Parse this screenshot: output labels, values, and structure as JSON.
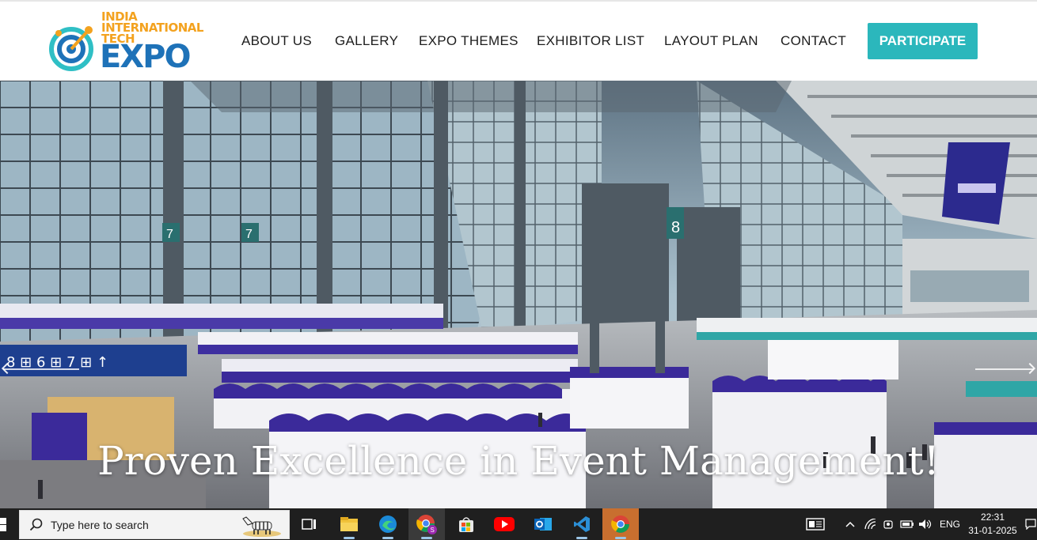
{
  "header": {
    "logo": {
      "line1": "INDIA",
      "line2": "INTERNATIONAL",
      "line3": "TECH",
      "expo": "EXPO"
    },
    "nav": [
      {
        "label": "ABOUT US"
      },
      {
        "label": "GALLERY"
      },
      {
        "label": "EXPO THEMES"
      },
      {
        "label": "EXHIBITOR LIST"
      },
      {
        "label": "LAYOUT PLAN"
      },
      {
        "label": "CONTACT"
      }
    ],
    "cta_label": "PARTICIPATE"
  },
  "hero": {
    "caption": "Proven Excellence in Event Management!",
    "signage": {
      "hall_numbers": [
        "8",
        "6",
        "7",
        "7",
        "8"
      ],
      "sign_text": "8 号门  6 号门   7 号门 ↑"
    }
  },
  "taskbar": {
    "search_placeholder": "Type here to search",
    "apps": [
      {
        "name": "task-view-icon"
      },
      {
        "name": "file-explorer-icon"
      },
      {
        "name": "edge-icon"
      },
      {
        "name": "chrome-profile-icon"
      },
      {
        "name": "microsoft-store-icon"
      },
      {
        "name": "youtube-icon"
      },
      {
        "name": "outlook-icon"
      },
      {
        "name": "vscode-icon"
      },
      {
        "name": "chrome-icon"
      }
    ],
    "language": "ENG",
    "time": "22:31",
    "date": "31-01-2025"
  },
  "colors": {
    "accent": "#2bb7bc",
    "logo_orange": "#f3a21f",
    "logo_blue": "#1e72b8",
    "booth_purple": "#3b2a9a"
  }
}
